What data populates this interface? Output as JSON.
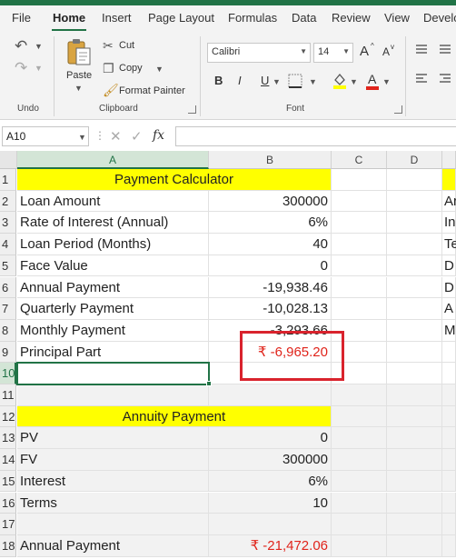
{
  "menu": {
    "tabs": [
      "File",
      "Home",
      "Insert",
      "Page Layout",
      "Formulas",
      "Data",
      "Review",
      "View",
      "Develo"
    ],
    "active": "Home"
  },
  "ribbon": {
    "undo_label": "Undo",
    "clipboard": {
      "paste": "Paste",
      "cut": "Cut",
      "copy": "Copy",
      "format_painter": "Format Painter",
      "label": "Clipboard"
    },
    "font": {
      "name": "Calibri",
      "size": "14",
      "bold": "B",
      "italic": "I",
      "underline": "U",
      "grow": "A",
      "shrink": "A",
      "label": "Font"
    }
  },
  "formula_bar": {
    "name_box": "A10",
    "fx": "fx",
    "formula": ""
  },
  "columns": [
    "A",
    "B",
    "C",
    "D"
  ],
  "rows": [
    {
      "n": "1",
      "a": "Payment Calculator",
      "b": "",
      "style": "title"
    },
    {
      "n": "2",
      "a": "Loan Amount",
      "b": "300000"
    },
    {
      "n": "3",
      "a": "Rate of Interest (Annual)",
      "b": "6%"
    },
    {
      "n": "4",
      "a": "Loan Period (Months)",
      "b": "40"
    },
    {
      "n": "5",
      "a": "Face Value",
      "b": "0"
    },
    {
      "n": "6",
      "a": "Annual Payment",
      "b": "-19,938.46"
    },
    {
      "n": "7",
      "a": "Quarterly Payment",
      "b": "-10,028.13"
    },
    {
      "n": "8",
      "a": "Monthly Payment",
      "b": "-3,293.66"
    },
    {
      "n": "9",
      "a": "Principal Part",
      "b": "₹ -6,965.20",
      "style": "red"
    },
    {
      "n": "10",
      "a": "",
      "b": ""
    },
    {
      "n": "11",
      "a": "",
      "b": "",
      "shade": true
    },
    {
      "n": "12",
      "a": "Annuity Payment",
      "b": "",
      "style": "title",
      "shade": true
    },
    {
      "n": "13",
      "a": "PV",
      "b": "0",
      "shade": true
    },
    {
      "n": "14",
      "a": "FV",
      "b": "300000",
      "shade": true
    },
    {
      "n": "15",
      "a": "Interest",
      "b": "6%",
      "shade": true
    },
    {
      "n": "16",
      "a": "Terms",
      "b": "10",
      "shade": true
    },
    {
      "n": "17",
      "a": "",
      "b": "",
      "shade": true
    },
    {
      "n": "18",
      "a": "Annual Payment",
      "b": "₹ -21,472.06",
      "style": "red",
      "shade": true
    }
  ],
  "right_clip": [
    "Ar",
    "In",
    "Te",
    "D",
    "D",
    "A",
    "M"
  ],
  "colors": {
    "accent": "#217346",
    "title_fill": "#ffff00",
    "negative": "#e0241b",
    "highlight": "#d9232d"
  }
}
